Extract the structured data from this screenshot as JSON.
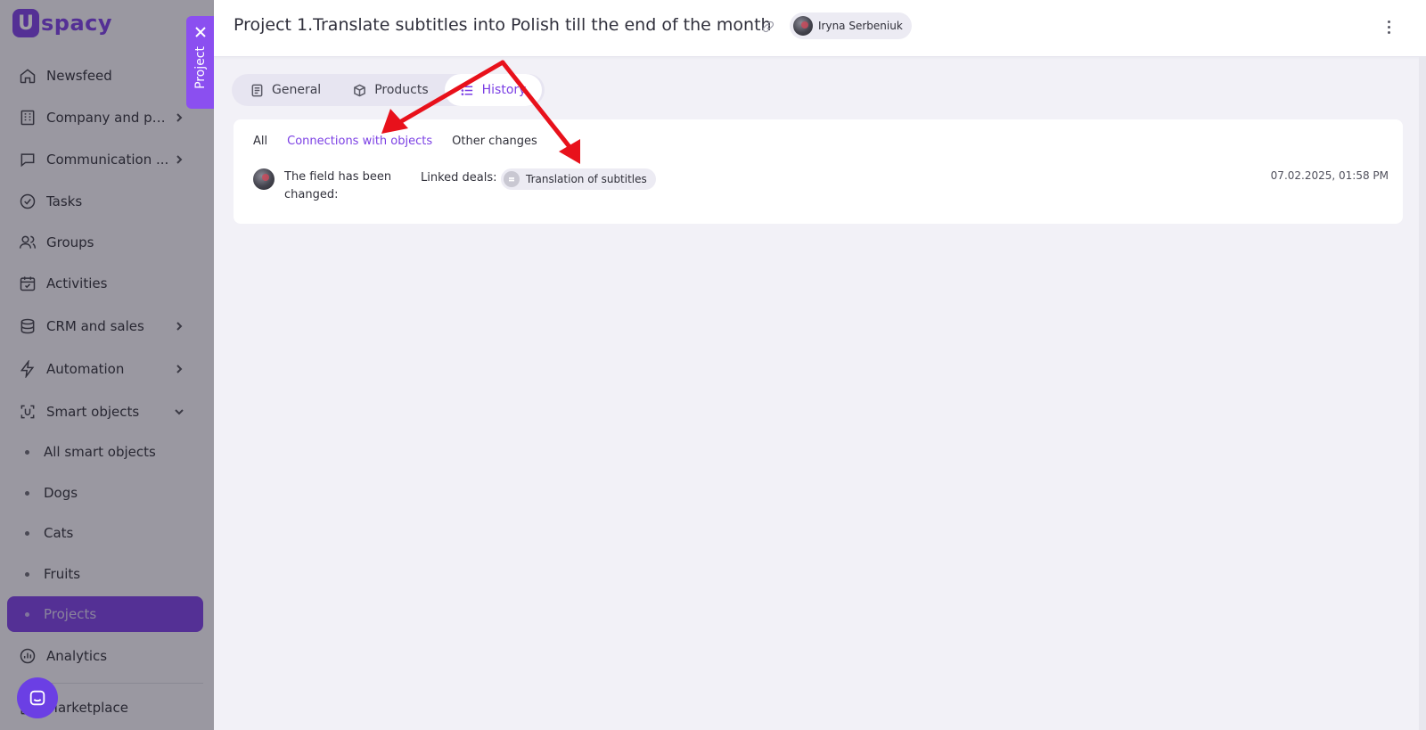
{
  "brand": {
    "logo_letter": "U",
    "logo_text": "spacy",
    "accent": "#7b3fe4"
  },
  "sidebar": {
    "items": [
      {
        "label": "Newsfeed",
        "icon": "home-icon"
      },
      {
        "label": "Company and pe...",
        "icon": "building-icon"
      },
      {
        "label": "Communication ...",
        "icon": "chat-icon"
      },
      {
        "label": "Tasks",
        "icon": "check-circle-icon"
      },
      {
        "label": "Groups",
        "icon": "users-icon"
      },
      {
        "label": "Activities",
        "icon": "calendar-icon"
      },
      {
        "label": "CRM and sales",
        "icon": "coins-icon"
      },
      {
        "label": "Automation",
        "icon": "lightning-icon"
      },
      {
        "label": "Smart objects",
        "icon": "smart-object-icon"
      }
    ],
    "smart_objects": [
      "All smart objects",
      "Dogs",
      "Cats",
      "Fruits",
      "Projects"
    ],
    "bottom_items": [
      {
        "label": "Analytics",
        "icon": "analytics-icon"
      },
      {
        "label": "Marketplace",
        "icon": "marketplace-icon"
      }
    ]
  },
  "side_tab": {
    "label": "Project"
  },
  "header": {
    "title": "Project 1.Translate subtitles into Polish till the end of the month",
    "user": "Iryna Serbeniuk"
  },
  "tabs": [
    {
      "label": "General",
      "icon": "document-icon"
    },
    {
      "label": "Products",
      "icon": "box-icon"
    },
    {
      "label": "History",
      "icon": "list-icon",
      "active": true
    }
  ],
  "history": {
    "filters": [
      {
        "label": "All"
      },
      {
        "label": "Connections with objects",
        "active": true
      },
      {
        "label": "Other changes"
      }
    ],
    "entry": {
      "text": "The field has been changed:",
      "field_label": "Linked deals:",
      "deal": "Translation of subtitles",
      "date": "07.02.2025, 01:58 PM"
    }
  },
  "colors": {
    "annotation_arrow": "#e8111b",
    "active_item": "#7b3fe4"
  }
}
